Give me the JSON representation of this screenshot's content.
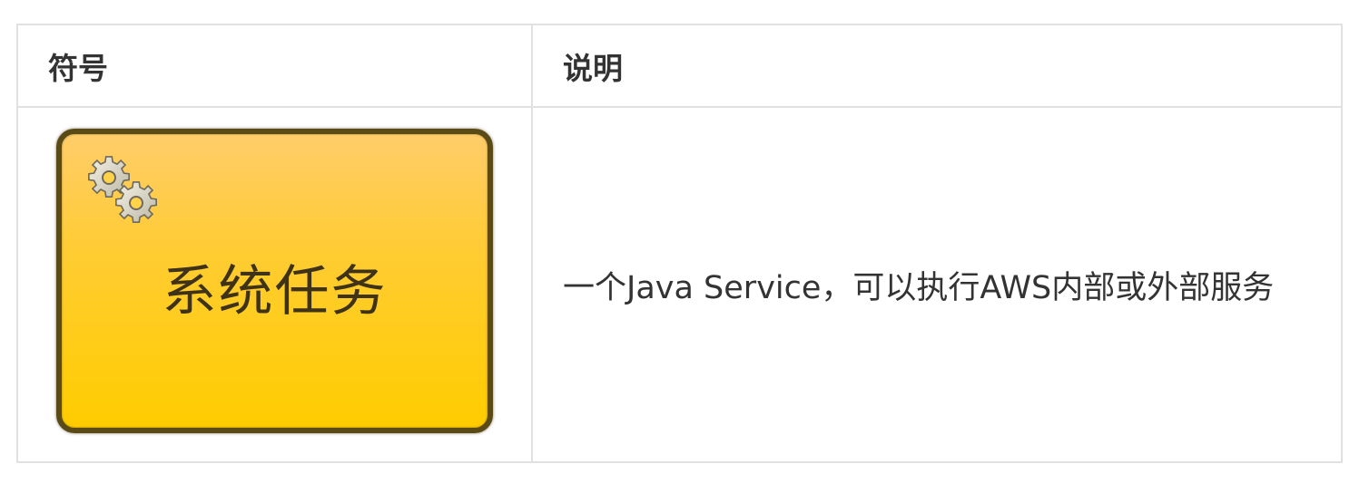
{
  "table": {
    "headers": {
      "symbol": "符号",
      "description": "说明"
    },
    "rows": [
      {
        "symbol": {
          "label": "系统任务",
          "icon": "gears-icon",
          "fill_color": "#ffcc00",
          "border_color": "#5a4a16"
        },
        "description": "一个Java Service，可以执行AWS内部或外部服务"
      }
    ]
  }
}
